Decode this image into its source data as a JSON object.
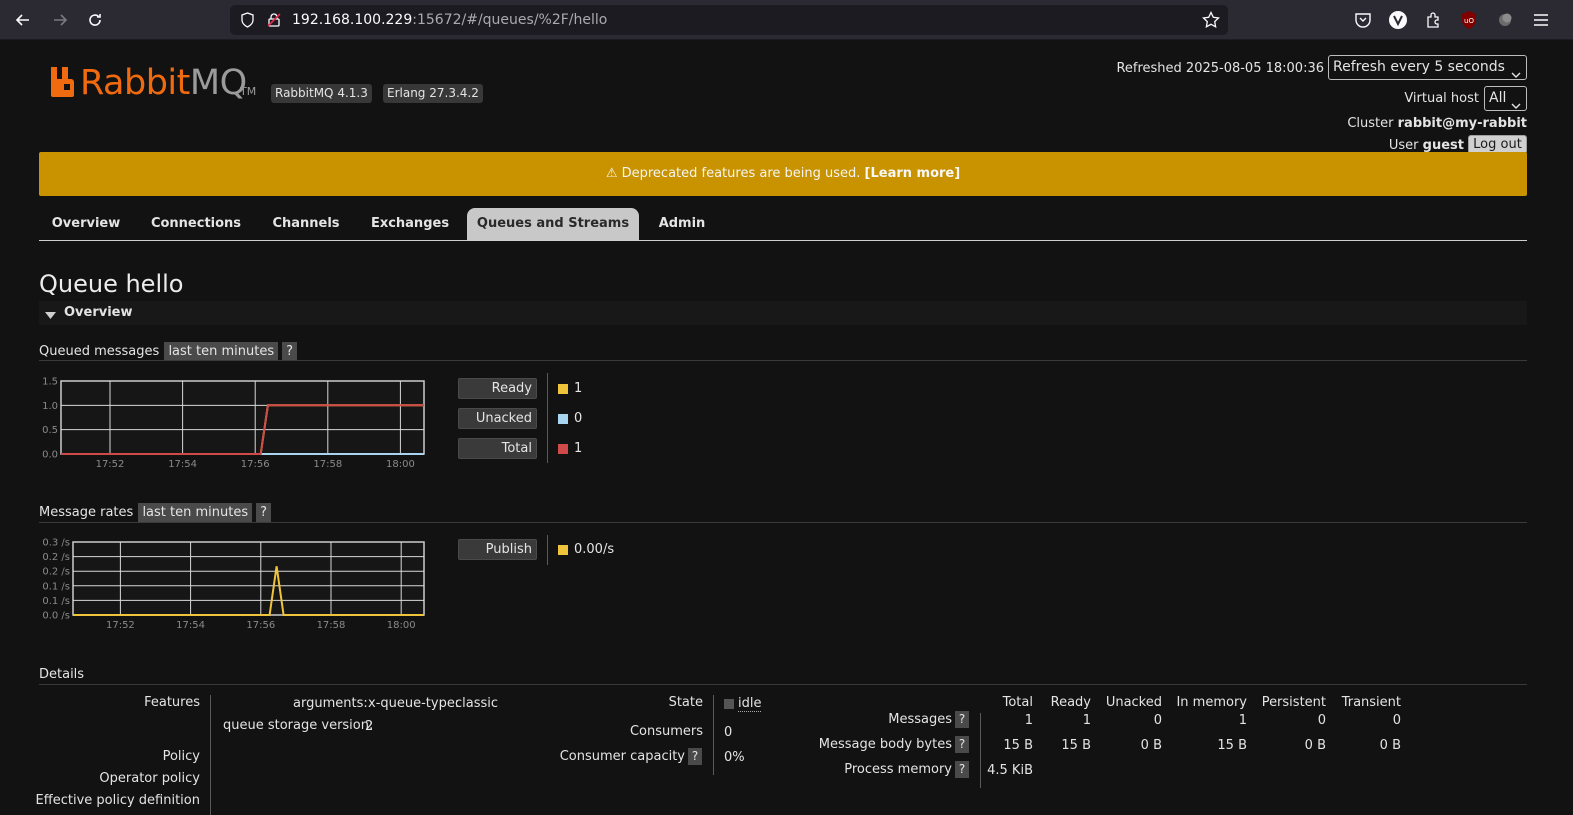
{
  "browser": {
    "url_host": "192.168.100.229",
    "url_path": ":15672/#/queues/%2F/hello"
  },
  "header": {
    "logo_rabbit": "Rabbit",
    "logo_mq": "MQ",
    "logo_tm": "TM",
    "rabbitmq_version": "RabbitMQ 4.1.3",
    "erlang_version": "Erlang 27.3.4.2",
    "refreshed_label": "Refreshed 2025-08-05 18:00:36",
    "refresh_select": "Refresh every 5 seconds",
    "vhost_label": "Virtual host",
    "vhost_select": "All",
    "cluster_label": "Cluster",
    "cluster_name": "rabbit@my-rabbit",
    "user_label": "User",
    "user_name": "guest",
    "logout": "Log out"
  },
  "warning": {
    "text": "⚠ Deprecated features are being used.",
    "link": "[Learn more]"
  },
  "tabs": [
    "Overview",
    "Connections",
    "Channels",
    "Exchanges",
    "Queues and Streams",
    "Admin"
  ],
  "active_tab": "Queues and Streams",
  "page": {
    "title": "Queue hello",
    "section": "Overview"
  },
  "queued_chart": {
    "title": "Queued messages",
    "range": "last ten minutes",
    "help": "?",
    "legend": [
      {
        "label": "Ready",
        "value": "1",
        "color": "#f0c43a"
      },
      {
        "label": "Unacked",
        "value": "0",
        "color": "#a8d4f0"
      },
      {
        "label": "Total",
        "value": "1",
        "color": "#d04a4a"
      }
    ]
  },
  "rates_chart": {
    "title": "Message rates",
    "range": "last ten minutes",
    "help": "?",
    "legend": [
      {
        "label": "Publish",
        "value": "0.00/s",
        "color": "#f0c43a"
      }
    ]
  },
  "chart_data": [
    {
      "type": "line",
      "x_ticks": [
        "17:52",
        "17:54",
        "17:56",
        "17:58",
        "18:00"
      ],
      "y_ticks": [
        "1.5",
        "1.0",
        "0.5",
        "0.0"
      ],
      "ylim": [
        0,
        1.5
      ],
      "x_minutes": [
        17.5,
        27.5
      ],
      "series": [
        {
          "name": "Ready",
          "color": "#f0c43a",
          "x": [
            0,
            5.5,
            5.7,
            10
          ],
          "y": [
            0,
            0,
            1,
            1
          ]
        },
        {
          "name": "Unacked",
          "color": "#a8d4f0",
          "x": [
            0,
            10
          ],
          "y": [
            0,
            0
          ]
        },
        {
          "name": "Total",
          "color": "#d04a4a",
          "x": [
            0,
            5.5,
            5.7,
            10
          ],
          "y": [
            0,
            0,
            1,
            1
          ]
        }
      ]
    },
    {
      "type": "line",
      "x_ticks": [
        "17:52",
        "17:54",
        "17:56",
        "17:58",
        "18:00"
      ],
      "y_ticks": [
        "0.3 /s",
        "0.2 /s",
        "0.2 /s",
        "0.1 /s",
        "0.1 /s",
        "0.0 /s"
      ],
      "ylim": [
        0,
        0.3
      ],
      "series": [
        {
          "name": "Publish",
          "color": "#f0c43a",
          "x": [
            0,
            5.6,
            5.8,
            6.0,
            10
          ],
          "y": [
            0,
            0,
            0.2,
            0,
            0
          ]
        }
      ]
    }
  ],
  "details": {
    "title": "Details",
    "features_label": "Features",
    "arguments_label": "arguments:",
    "arg_key": "x-queue-type:",
    "arg_val": "classic",
    "storage_label": "queue storage version:",
    "storage_val": "2",
    "policy_label": "Policy",
    "operator_policy_label": "Operator policy",
    "effective_policy_label": "Effective policy definition",
    "state_label": "State",
    "state_val": "idle",
    "consumers_label": "Consumers",
    "consumers_val": "0",
    "capacity_label": "Consumer capacity",
    "capacity_val": "0%",
    "help": "?",
    "msg_table": {
      "columns": [
        "Total",
        "Ready",
        "Unacked",
        "In memory",
        "Persistent",
        "Transient"
      ],
      "rows": [
        {
          "label": "Messages",
          "values": [
            "1",
            "1",
            "0",
            "1",
            "0",
            "0"
          ]
        },
        {
          "label": "Message body bytes",
          "values": [
            "15 B",
            "15 B",
            "0 B",
            "15 B",
            "0 B",
            "0 B"
          ]
        },
        {
          "label": "Process memory",
          "values": [
            "4.5 KiB"
          ]
        }
      ]
    }
  }
}
